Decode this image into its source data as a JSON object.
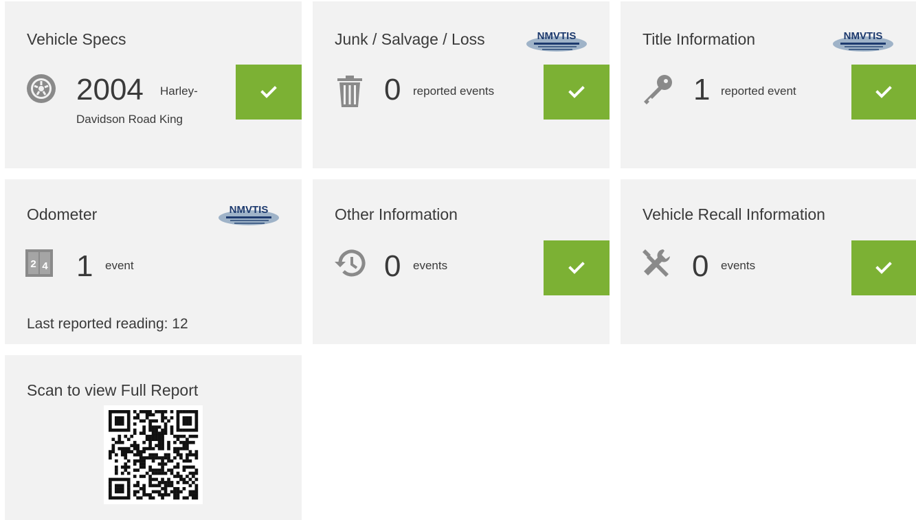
{
  "cards": {
    "vehicle_specs": {
      "title": "Vehicle Specs",
      "year": "2004",
      "model_line1": "Harley-",
      "model_line2": "Davidson Road King",
      "status": "ok"
    },
    "junk_salvage": {
      "title": "Junk / Salvage / Loss",
      "count": "0",
      "label": "reported events",
      "status": "ok",
      "badge": "NMVTIS"
    },
    "title_info": {
      "title": "Title Information",
      "count": "1",
      "label": "reported event",
      "status": "ok",
      "badge": "NMVTIS"
    },
    "odometer": {
      "title": "Odometer",
      "count": "1",
      "label": "event",
      "reading": "Last reported reading: 12",
      "badge": "NMVTIS"
    },
    "other_info": {
      "title": "Other Information",
      "count": "0",
      "label": "events",
      "status": "ok"
    },
    "recall_info": {
      "title": "Vehicle Recall Information",
      "count": "0",
      "label": "events",
      "status": "ok"
    },
    "qr": {
      "title": "Scan to view Full Report"
    }
  },
  "icons": {
    "vehicle_specs": "tire-icon",
    "junk_salvage": "trash-icon",
    "title_info": "key-icon",
    "odometer": "odometer-icon",
    "other_info": "history-icon",
    "recall_info": "tools-icon",
    "check": "checkmark-icon"
  },
  "colors": {
    "card_bg": "#f2f2f2",
    "check_green": "#7cb134",
    "icon_gray": "#8a8a8a",
    "text": "#3a3a3a"
  }
}
